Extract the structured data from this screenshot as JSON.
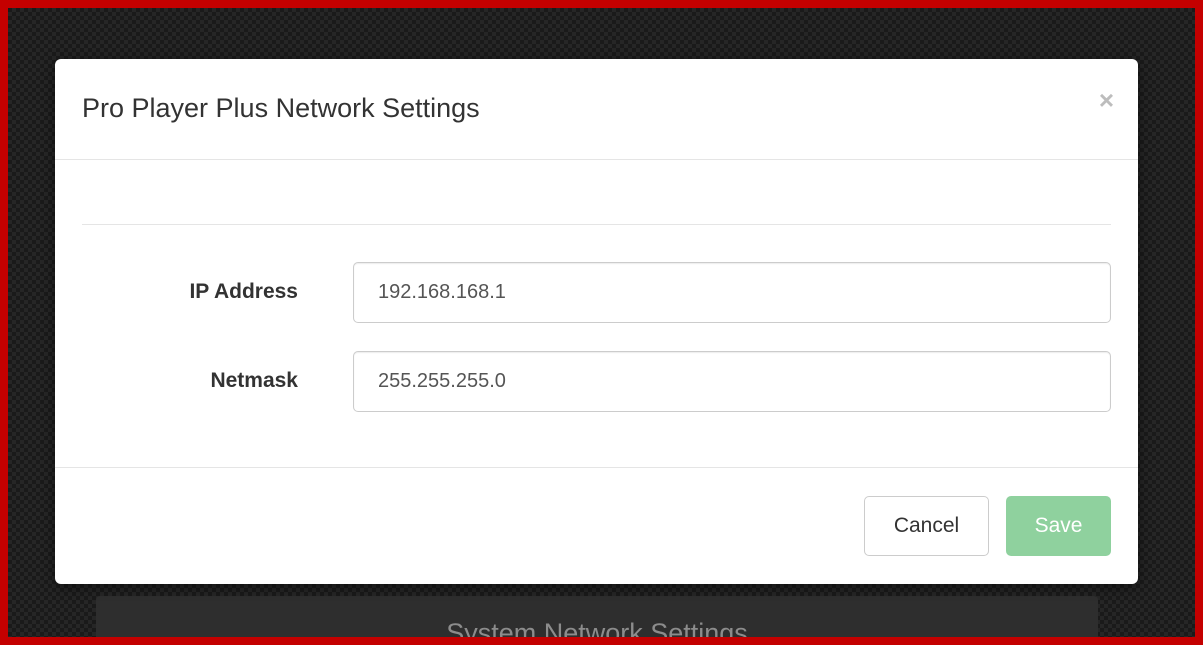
{
  "background": {
    "button_label": "System Network Settings"
  },
  "modal": {
    "title": "Pro Player Plus Network Settings",
    "close_glyph": "×",
    "fields": [
      {
        "label": "IP Address",
        "value": "192.168.168.1"
      },
      {
        "label": "Netmask",
        "value": "255.255.255.0"
      }
    ],
    "footer": {
      "cancel_label": "Cancel",
      "save_label": "Save"
    }
  },
  "colors": {
    "frame_border": "#c40000",
    "save_button_disabled": "#8fd19e"
  }
}
